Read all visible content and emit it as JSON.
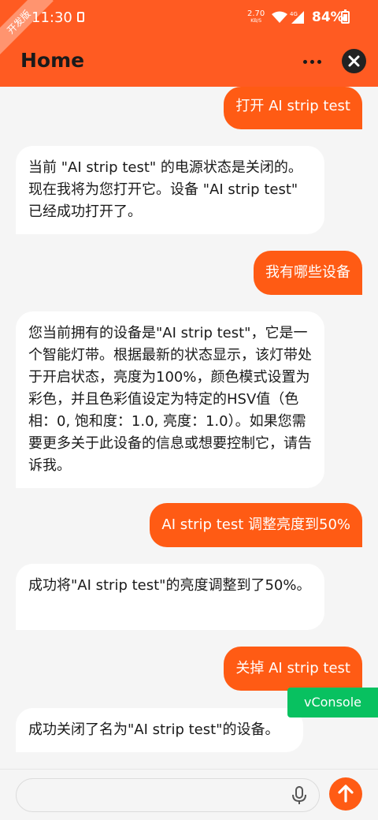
{
  "status_bar": {
    "time": "11:30",
    "net_speed_value": "2.70",
    "net_speed_unit": "KB/S",
    "network_type": "4G",
    "battery": "84%",
    "dev_badge": "开发版"
  },
  "header": {
    "title": "Home",
    "more_icon": "more-icon",
    "close_icon": "close-icon"
  },
  "messages": [
    {
      "role": "user",
      "text": "打开 AI strip test"
    },
    {
      "role": "ai",
      "text": "当前 \"AI strip test\" 的电源状态是关闭的。现在我将为您打开它。设备 \"AI strip test\" 已经成功打开了。"
    },
    {
      "role": "user",
      "text": "我有哪些设备"
    },
    {
      "role": "ai",
      "text": "您当前拥有的设备是\"AI strip test\"，它是一个智能灯带。根据最新的状态显示，该灯带处于开启状态，亮度为100%，颜色模式设置为彩色，并且色彩值设定为特定的HSV值（色相：0, 饱和度：1.0, 亮度：1.0）。如果您需要更多关于此设备的信息或想要控制它，请告诉我。"
    },
    {
      "role": "user",
      "text": "AI strip test 调整亮度到50%"
    },
    {
      "role": "ai",
      "text": "成功将\"AI strip test\"的亮度调整到了50%。"
    },
    {
      "role": "user",
      "text": "关掉 AI strip test"
    },
    {
      "role": "ai",
      "text": "成功关闭了名为\"AI strip test\"的设备。"
    }
  ],
  "vconsole": {
    "label": "vConsole"
  },
  "composer": {
    "input_value": "",
    "placeholder": "",
    "mic_icon": "mic-icon",
    "send_icon": "arrow-up-icon"
  },
  "colors": {
    "accent": "#ff5b14",
    "background": "#f5f5f5",
    "vconsole": "#08c160"
  }
}
